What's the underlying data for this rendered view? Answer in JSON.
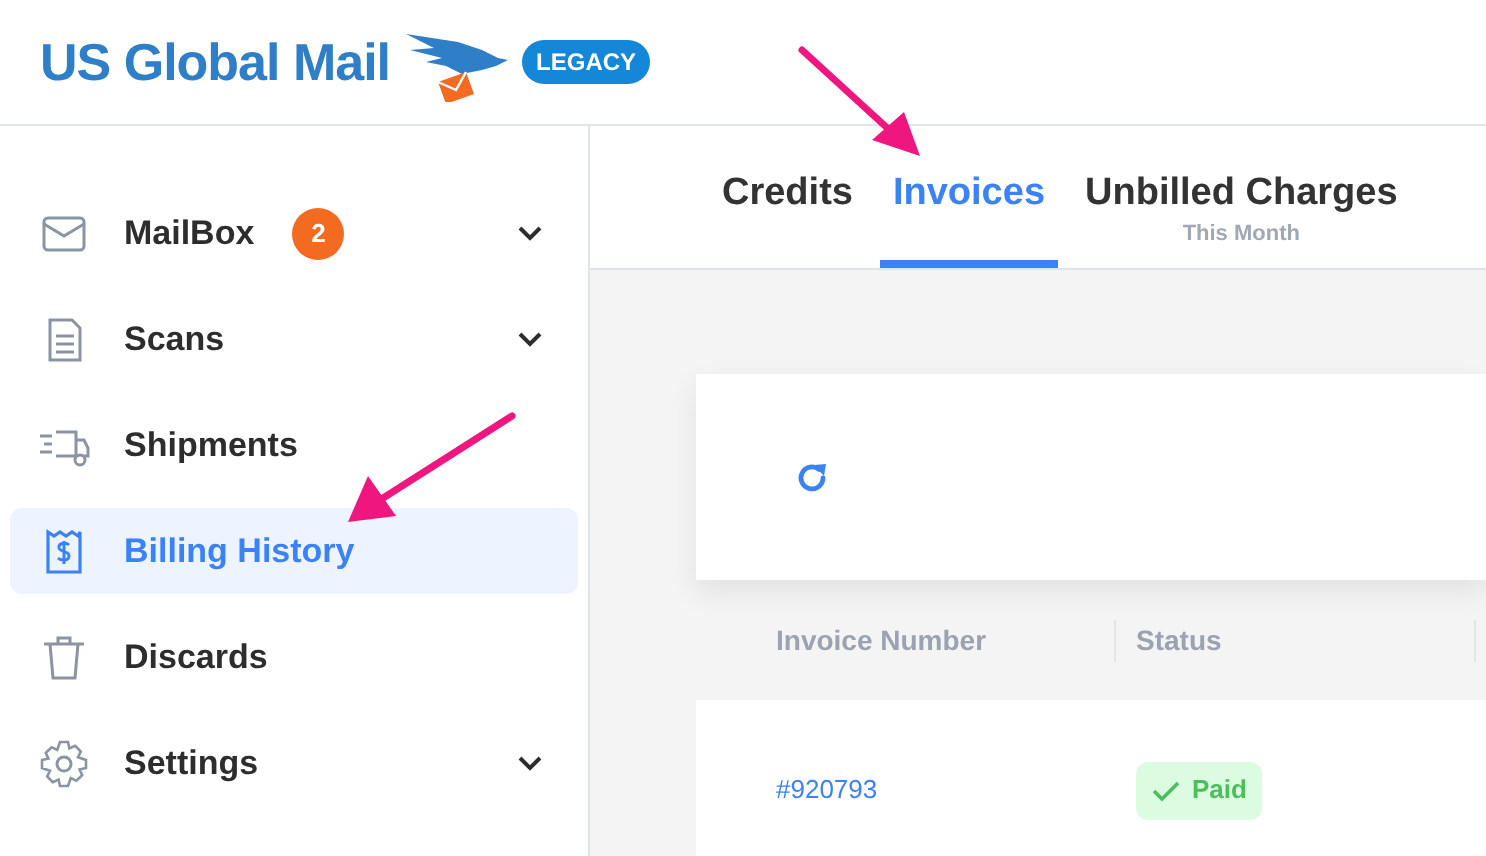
{
  "logo": {
    "text": "US Global Mail",
    "badge": "LEGACY"
  },
  "sidebar": {
    "items": [
      {
        "kind": "mail",
        "label": "MailBox",
        "badge": "2",
        "expandable": true,
        "selected": false
      },
      {
        "kind": "scan",
        "label": "Scans",
        "expandable": true,
        "selected": false
      },
      {
        "kind": "truck",
        "label": "Shipments",
        "expandable": false,
        "selected": false
      },
      {
        "kind": "bill",
        "label": "Billing History",
        "expandable": false,
        "selected": true
      },
      {
        "kind": "trash",
        "label": "Discards",
        "expandable": false,
        "selected": false
      },
      {
        "kind": "gear",
        "label": "Settings",
        "expandable": true,
        "selected": false
      }
    ]
  },
  "tabs": [
    {
      "label": "Credits",
      "selected": false
    },
    {
      "label": "Invoices",
      "selected": true
    },
    {
      "label": "Unbilled Charges",
      "sublabel": "This Month",
      "selected": false
    }
  ],
  "table": {
    "columns": [
      "Invoice Number",
      "Status"
    ],
    "rows": [
      {
        "invoice_number": "#920793",
        "status": "Paid"
      }
    ]
  }
}
